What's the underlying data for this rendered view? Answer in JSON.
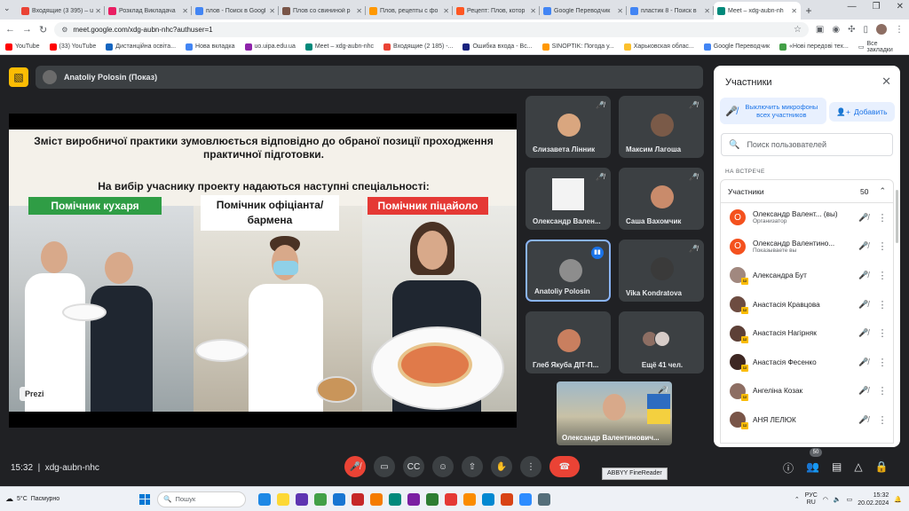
{
  "browser": {
    "tabs": [
      {
        "label": "Входящие (3 395) – u",
        "color": "#ea4335",
        "active": false
      },
      {
        "label": "Розклад Викладача",
        "color": "#e91e63",
        "active": false
      },
      {
        "label": "плов - Поиск в Googl",
        "color": "#4285f4",
        "active": false
      },
      {
        "label": "Плов со свининой р",
        "color": "#795548",
        "active": false
      },
      {
        "label": "Плов, рецепты с фо",
        "color": "#ff9800",
        "active": false
      },
      {
        "label": "Рецепт: Плов, котор",
        "color": "#ff5722",
        "active": false
      },
      {
        "label": "Google Переводчик",
        "color": "#4285f4",
        "active": false
      },
      {
        "label": "пластик 8 - Поиск в",
        "color": "#4285f4",
        "active": false
      },
      {
        "label": "Meet – xdg-aubn-nh",
        "color": "#00897b",
        "active": true
      }
    ],
    "url": "meet.google.com/xdg-aubn-nhc?authuser=1",
    "bookmarks": [
      {
        "label": "YouTube",
        "color": "#ff0000"
      },
      {
        "label": "(33) YouTube",
        "color": "#ff0000"
      },
      {
        "label": "Дистанційна освіта...",
        "color": "#1565c0"
      },
      {
        "label": "Нова вкладка",
        "color": "#4285f4"
      },
      {
        "label": "uo.uipa.edu.ua",
        "color": "#8e24aa"
      },
      {
        "label": "Meet – xdg-aubn-nhc",
        "color": "#00897b"
      },
      {
        "label": "Входящие (2 185) -...",
        "color": "#ea4335"
      },
      {
        "label": "Ошибка входа - Вс...",
        "color": "#1a237e"
      },
      {
        "label": "SINOPTIK: Погода у...",
        "color": "#ff9800"
      },
      {
        "label": "Харьковская облас...",
        "color": "#fbc02d"
      },
      {
        "label": "Google Переводчик",
        "color": "#4285f4"
      },
      {
        "label": "«Нові передові тех...",
        "color": "#43a047"
      }
    ],
    "all_bookmarks": "Все закладки"
  },
  "meet": {
    "presenter": "Anatoliy Polosin (Показ)",
    "slide": {
      "heading": "Зміст виробничої практики зумовлюється відповідно до обраної позиції проходження практичної підготовки.",
      "subheading": "На вибір учаснику проекту надаються наступні спеціальності:",
      "label1": "Помічник кухаря",
      "label2": "Помічник офіціанта/ бармена",
      "label3": "Помічник піцайоло",
      "watermark": "Prezi"
    },
    "tiles": [
      {
        "name": "Єлизавета Лінник",
        "color": "#d9a67f"
      },
      {
        "name": "Максим Лагоша",
        "color": "#7a5a48"
      },
      {
        "name": "Олександр Вален...",
        "color": "#9e9e9e"
      },
      {
        "name": "Саша Вахомчик",
        "color": "#c98b6b"
      },
      {
        "name": "Anatoliy Polosin",
        "color": "#8d8d8d"
      },
      {
        "name": "Vika Kondratova",
        "color": "#3a3a3a"
      },
      {
        "name": "Глеб Якуба ДІТ-П...",
        "color": "#c97f5f"
      },
      {
        "name": "Ещё 41 чел.",
        "color": "#a0826d"
      }
    ],
    "self_view": "Олександр Валентинович...",
    "time": "15:32",
    "meeting_code": "xdg-aubn-nhc",
    "tooltip": "ABBYY FineReader",
    "people_count": "50"
  },
  "panel": {
    "title": "Участники",
    "mute_all": "Выключить микрофоны всех участников",
    "add": "Добавить",
    "search_placeholder": "Поиск пользователей",
    "section": "НА ВСТРЕЧЕ",
    "group_label": "Участники",
    "group_count": "50",
    "participants": [
      {
        "name": "Олександр Валент... (вы)",
        "sub": "Организатор",
        "color": "#f4511e",
        "initial": "О"
      },
      {
        "name": "Олександр Валентино...",
        "sub": "Показываете вы",
        "color": "#f4511e",
        "initial": "О"
      },
      {
        "name": "Александра Бут",
        "sub": "",
        "color": "#a1887f",
        "initial": ""
      },
      {
        "name": "Анастасія Кравцова",
        "sub": "",
        "color": "#6d4c41",
        "initial": ""
      },
      {
        "name": "Анастасія Нагірняк",
        "sub": "",
        "color": "#5d4037",
        "initial": ""
      },
      {
        "name": "Анастасія Фесенко",
        "sub": "",
        "color": "#3e2723",
        "initial": ""
      },
      {
        "name": "Ангеліна Козак",
        "sub": "",
        "color": "#8d6e63",
        "initial": ""
      },
      {
        "name": "АНЯ ЛЕЛЮК",
        "sub": "",
        "color": "#795548",
        "initial": ""
      }
    ]
  },
  "taskbar": {
    "weather_temp": "5°C",
    "weather_text": "Пасмурно",
    "search": "Пошук",
    "lang_top": "РУС",
    "lang_bottom": "RU",
    "clock_time": "15:32",
    "clock_date": "20.02.2024"
  }
}
